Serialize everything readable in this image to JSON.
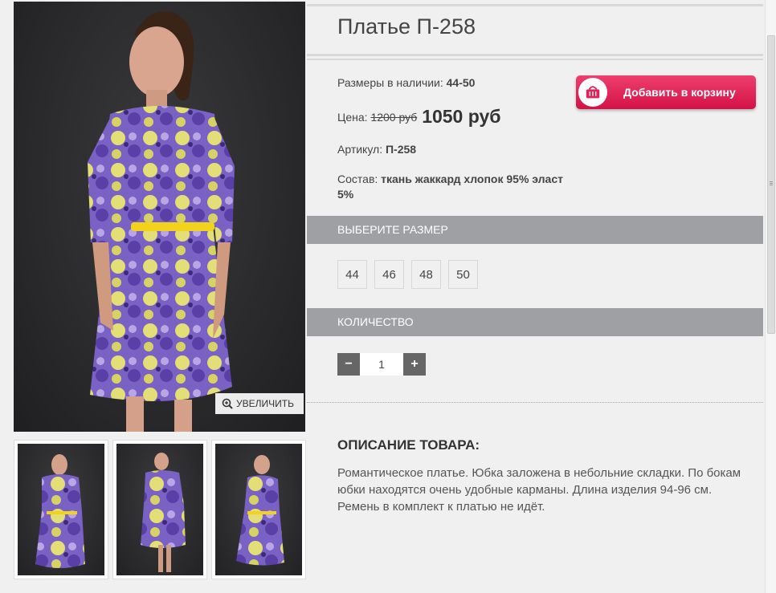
{
  "product": {
    "title": "Платье П-258",
    "sizes_label": "Размеры в наличии:",
    "sizes_value": "44-50",
    "price_label": "Цена:",
    "price_old": "1200 руб",
    "price_new": "1050 руб",
    "sku_label": "Артикул:",
    "sku_value": "П-258",
    "composition_label": "Состав:",
    "composition_value": "ткань жаккард хлопок 95% эласт 5%"
  },
  "cart_button": {
    "label": "Добавить в корзину",
    "icon": "basket-icon"
  },
  "zoom_button": {
    "label": "УВЕЛИЧИТЬ",
    "icon": "zoom-in-icon"
  },
  "size_section": {
    "header": "ВЫБЕРИТЕ РАЗМЕР",
    "options": [
      "44",
      "46",
      "48",
      "50"
    ]
  },
  "quantity_section": {
    "header": "КОЛИЧЕСТВО",
    "minus": "−",
    "plus": "+",
    "value": "1"
  },
  "description": {
    "title": "ОПИСАНИЕ ТОВАРА:",
    "text": "Романтическое платье. Юбка заложена в небольние складки. По бокам юбки находятся очень удобные карманы. Длина изделия 94-96 см. Ремень в комплект к платью не идёт."
  },
  "colors": {
    "accent_red": "#e0245a",
    "section_bar": "#9ea0a3",
    "photo_background": "#2c2c2e",
    "dress_purple": "#7b5fc0",
    "dress_yellow": "#e8e070",
    "belt_yellow": "#f2d21a"
  }
}
